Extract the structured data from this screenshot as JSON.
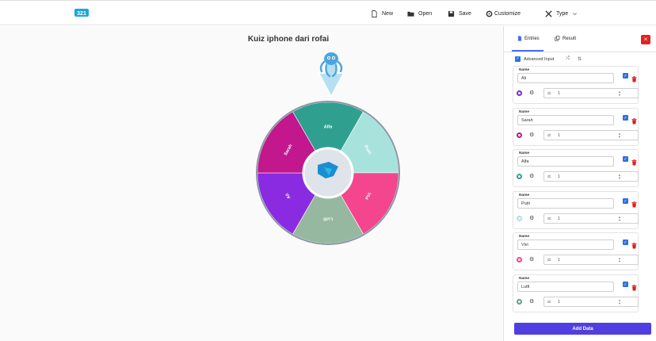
{
  "toolbar": {
    "new_label": "New",
    "open_label": "Open",
    "save_label": "Save",
    "customize_label": "Customize",
    "type_label": "Type"
  },
  "wheel": {
    "title": "Kuiz iphone dari rofai",
    "segments": [
      {
        "label": "Alfa",
        "color": "#2fa08f"
      },
      {
        "label": "Putri",
        "color": "#a7e3dc"
      },
      {
        "label": "Vivi",
        "color": "#f3468e"
      },
      {
        "label": "Lutfi",
        "color": "#97b8a0"
      },
      {
        "label": "Ali",
        "color": "#8a2be2"
      },
      {
        "label": "Sarah",
        "color": "#c2178d"
      }
    ]
  },
  "sidebar": {
    "tab_entries": "Entries",
    "tab_result": "Result",
    "advanced_input_label": "Advanced Input",
    "name_label": "Name",
    "entries": [
      {
        "name": "Ali",
        "weight": "1",
        "palette_color": "#7a2be0"
      },
      {
        "name": "Sarah",
        "weight": "1",
        "palette_color": "#c2178d"
      },
      {
        "name": "Alfa",
        "weight": "1",
        "palette_color": "#2fa08f"
      },
      {
        "name": "Putri",
        "weight": "1",
        "palette_color": "#a7e3dc"
      },
      {
        "name": "Vivi",
        "weight": "1",
        "palette_color": "#f3468e"
      },
      {
        "name": "Lutfi",
        "weight": "1",
        "palette_color": "#5fa08a"
      }
    ],
    "add_data_label": "Add Data"
  }
}
